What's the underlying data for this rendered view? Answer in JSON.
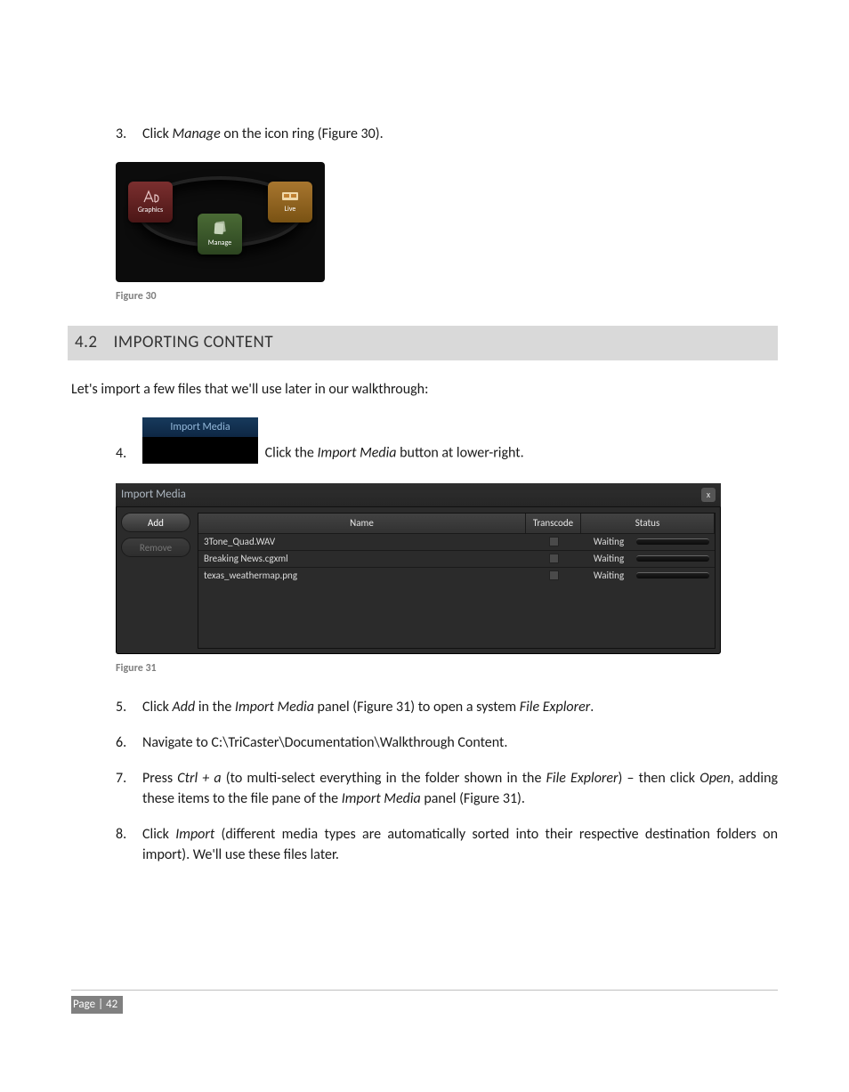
{
  "step3": {
    "num": "3.",
    "text_before": "Click ",
    "em": "Manage",
    "text_after": " on the icon ring (Figure 30)."
  },
  "icon_ring": {
    "graphics": "Graphics",
    "live": "Live",
    "manage": "Manage"
  },
  "caption30": "Figure 30",
  "section": {
    "num": "4.2",
    "title": "IMPORTING CONTENT"
  },
  "intro": "Let's import a few files that we'll use later in our walkthrough:",
  "step4": {
    "num": "4.",
    "btn_label": "Import Media",
    "text_before": "Click the ",
    "em": "Import Media",
    "text_after": " button at lower-right."
  },
  "import_panel": {
    "title": "Import Media",
    "close": "x",
    "add": "Add",
    "remove": "Remove",
    "columns": {
      "name": "Name",
      "transcode": "Transcode",
      "status": "Status"
    },
    "rows": [
      {
        "name": "3Tone_Quad.WAV",
        "status": "Waiting"
      },
      {
        "name": "Breaking News.cgxml",
        "status": "Waiting"
      },
      {
        "name": "texas_weathermap.png",
        "status": "Waiting"
      }
    ]
  },
  "caption31": "Figure 31",
  "step5": {
    "num": "5.",
    "p1": "Click ",
    "e1": "Add",
    "p2": " in the ",
    "e2": "Import Media",
    "p3": " panel (Figure 31) to open a system ",
    "e3": "File Explorer",
    "p4": "."
  },
  "step6": {
    "num": "6.",
    "text": "Navigate to C:\\TriCaster\\Documentation\\Walkthrough Content."
  },
  "step7": {
    "num": "7.",
    "p1": "Press ",
    "e1": "Ctrl + a",
    "p2": " (to multi-select everything in the folder shown in the ",
    "e2": "File Explorer",
    "p3": ") – then click ",
    "e3": "Open",
    "p4": ", adding these items to the file pane of the ",
    "e4": "Import Media",
    "p5": " panel (Figure 31)."
  },
  "step8": {
    "num": "8.",
    "p1": "Click ",
    "e1": "Import",
    "p2": " (different media types are automatically sorted into their respective destination folders on import).  We'll use these files later."
  },
  "footer": {
    "page": "Page | 42"
  }
}
